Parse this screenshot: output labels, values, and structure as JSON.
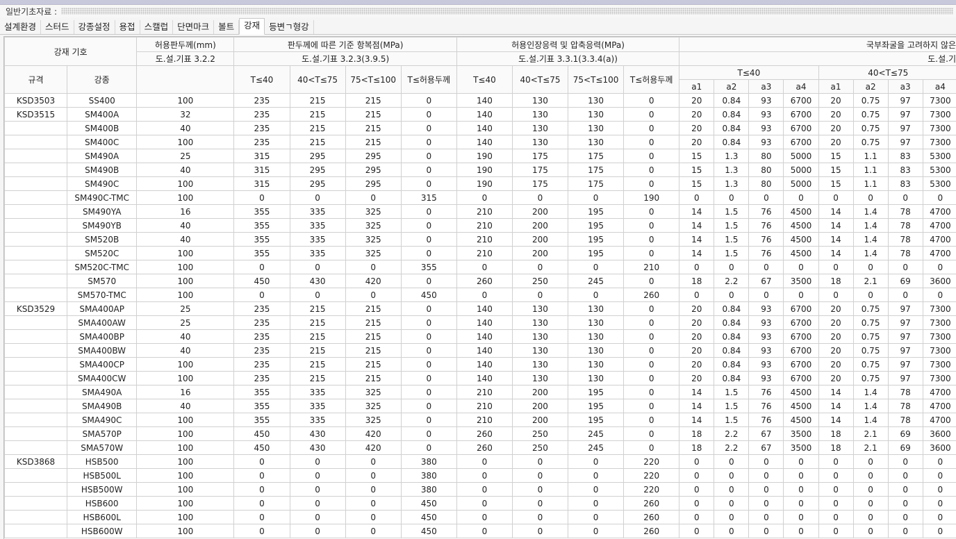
{
  "window": {
    "title": "일반기초자료 :"
  },
  "tabs": [
    {
      "label": "설계환경",
      "active": false
    },
    {
      "label": "스터드",
      "active": false
    },
    {
      "label": "강종설정",
      "active": false
    },
    {
      "label": "용접",
      "active": false
    },
    {
      "label": "스캘럽",
      "active": false
    },
    {
      "label": "단면마크",
      "active": false
    },
    {
      "label": "볼트",
      "active": false
    },
    {
      "label": "강재",
      "active": true
    },
    {
      "label": "등변ㄱ형강",
      "active": false
    }
  ],
  "header": {
    "steel_symbol": "강재 기호",
    "allow_thick": "허용판두께(mm)",
    "allow_thick_ref": "도.설.기표 3.2.2",
    "yield": "판두께에 따른 기준 항복점(MPa)",
    "yield_ref": "도.설.기표 3.2.3(3.9.5)",
    "tensile": "허용인장응력 및 압축응력(MPa)",
    "tensile_ref": "도.설.기표 3.3.1(3.3.4(a))",
    "buckling": "국부좌굴을 고려하지 않은",
    "buckling_ref": "도.설.기",
    "spec": "규격",
    "grade": "강종",
    "sub": [
      "T≤40",
      "40<T≤75",
      "75<T≤100",
      "T≤허용두께",
      "T≤40",
      "40<T≤75",
      "75<T≤100",
      "T≤허용두께"
    ],
    "group1": "T≤40",
    "group2": "40<T≤75",
    "alabels": [
      "a1",
      "a2",
      "a3",
      "a4",
      "a1",
      "a2",
      "a3",
      "a4"
    ]
  },
  "rows": [
    [
      "KSD3503",
      "SS400",
      "100",
      "235",
      "215",
      "215",
      "0",
      "140",
      "130",
      "130",
      "0",
      "20",
      "0.84",
      "93",
      "6700",
      "20",
      "0.75",
      "97",
      "7300"
    ],
    [
      "KSD3515",
      "SM400A",
      "32",
      "235",
      "215",
      "215",
      "0",
      "140",
      "130",
      "130",
      "0",
      "20",
      "0.84",
      "93",
      "6700",
      "20",
      "0.75",
      "97",
      "7300"
    ],
    [
      "",
      "SM400B",
      "40",
      "235",
      "215",
      "215",
      "0",
      "140",
      "130",
      "130",
      "0",
      "20",
      "0.84",
      "93",
      "6700",
      "20",
      "0.75",
      "97",
      "7300"
    ],
    [
      "",
      "SM400C",
      "100",
      "235",
      "215",
      "215",
      "0",
      "140",
      "130",
      "130",
      "0",
      "20",
      "0.84",
      "93",
      "6700",
      "20",
      "0.75",
      "97",
      "7300"
    ],
    [
      "",
      "SM490A",
      "25",
      "315",
      "295",
      "295",
      "0",
      "190",
      "175",
      "175",
      "0",
      "15",
      "1.3",
      "80",
      "5000",
      "15",
      "1.1",
      "83",
      "5300"
    ],
    [
      "",
      "SM490B",
      "40",
      "315",
      "295",
      "295",
      "0",
      "190",
      "175",
      "175",
      "0",
      "15",
      "1.3",
      "80",
      "5000",
      "15",
      "1.1",
      "83",
      "5300"
    ],
    [
      "",
      "SM490C",
      "100",
      "315",
      "295",
      "295",
      "0",
      "190",
      "175",
      "175",
      "0",
      "15",
      "1.3",
      "80",
      "5000",
      "15",
      "1.1",
      "83",
      "5300"
    ],
    [
      "",
      "SM490C-TMC",
      "100",
      "0",
      "0",
      "0",
      "315",
      "0",
      "0",
      "0",
      "190",
      "0",
      "0",
      "0",
      "0",
      "0",
      "0",
      "0",
      "0"
    ],
    [
      "",
      "SM490YA",
      "16",
      "355",
      "335",
      "325",
      "0",
      "210",
      "200",
      "195",
      "0",
      "14",
      "1.5",
      "76",
      "4500",
      "14",
      "1.4",
      "78",
      "4700"
    ],
    [
      "",
      "SM490YB",
      "40",
      "355",
      "335",
      "325",
      "0",
      "210",
      "200",
      "195",
      "0",
      "14",
      "1.5",
      "76",
      "4500",
      "14",
      "1.4",
      "78",
      "4700"
    ],
    [
      "",
      "SM520B",
      "40",
      "355",
      "335",
      "325",
      "0",
      "210",
      "200",
      "195",
      "0",
      "14",
      "1.5",
      "76",
      "4500",
      "14",
      "1.4",
      "78",
      "4700"
    ],
    [
      "",
      "SM520C",
      "100",
      "355",
      "335",
      "325",
      "0",
      "210",
      "200",
      "195",
      "0",
      "14",
      "1.5",
      "76",
      "4500",
      "14",
      "1.4",
      "78",
      "4700"
    ],
    [
      "",
      "SM520C-TMC",
      "100",
      "0",
      "0",
      "0",
      "355",
      "0",
      "0",
      "0",
      "210",
      "0",
      "0",
      "0",
      "0",
      "0",
      "0",
      "0",
      "0"
    ],
    [
      "",
      "SM570",
      "100",
      "450",
      "430",
      "420",
      "0",
      "260",
      "250",
      "245",
      "0",
      "18",
      "2.2",
      "67",
      "3500",
      "18",
      "2.1",
      "69",
      "3600"
    ],
    [
      "",
      "SM570-TMC",
      "100",
      "0",
      "0",
      "0",
      "450",
      "0",
      "0",
      "0",
      "260",
      "0",
      "0",
      "0",
      "0",
      "0",
      "0",
      "0",
      "0"
    ],
    [
      "KSD3529",
      "SMA400AP",
      "25",
      "235",
      "215",
      "215",
      "0",
      "140",
      "130",
      "130",
      "0",
      "20",
      "0.84",
      "93",
      "6700",
      "20",
      "0.75",
      "97",
      "7300"
    ],
    [
      "",
      "SMA400AW",
      "25",
      "235",
      "215",
      "215",
      "0",
      "140",
      "130",
      "130",
      "0",
      "20",
      "0.84",
      "93",
      "6700",
      "20",
      "0.75",
      "97",
      "7300"
    ],
    [
      "",
      "SMA400BP",
      "40",
      "235",
      "215",
      "215",
      "0",
      "140",
      "130",
      "130",
      "0",
      "20",
      "0.84",
      "93",
      "6700",
      "20",
      "0.75",
      "97",
      "7300"
    ],
    [
      "",
      "SMA400BW",
      "40",
      "235",
      "215",
      "215",
      "0",
      "140",
      "130",
      "130",
      "0",
      "20",
      "0.84",
      "93",
      "6700",
      "20",
      "0.75",
      "97",
      "7300"
    ],
    [
      "",
      "SMA400CP",
      "100",
      "235",
      "215",
      "215",
      "0",
      "140",
      "130",
      "130",
      "0",
      "20",
      "0.84",
      "93",
      "6700",
      "20",
      "0.75",
      "97",
      "7300"
    ],
    [
      "",
      "SMA400CW",
      "100",
      "235",
      "215",
      "215",
      "0",
      "140",
      "130",
      "130",
      "0",
      "20",
      "0.84",
      "93",
      "6700",
      "20",
      "0.75",
      "97",
      "7300"
    ],
    [
      "",
      "SMA490A",
      "16",
      "355",
      "335",
      "325",
      "0",
      "210",
      "200",
      "195",
      "0",
      "14",
      "1.5",
      "76",
      "4500",
      "14",
      "1.4",
      "78",
      "4700"
    ],
    [
      "",
      "SMA490B",
      "40",
      "355",
      "335",
      "325",
      "0",
      "210",
      "200",
      "195",
      "0",
      "14",
      "1.5",
      "76",
      "4500",
      "14",
      "1.4",
      "78",
      "4700"
    ],
    [
      "",
      "SMA490C",
      "100",
      "355",
      "335",
      "325",
      "0",
      "210",
      "200",
      "195",
      "0",
      "14",
      "1.5",
      "76",
      "4500",
      "14",
      "1.4",
      "78",
      "4700"
    ],
    [
      "",
      "SMA570P",
      "100",
      "450",
      "430",
      "420",
      "0",
      "260",
      "250",
      "245",
      "0",
      "18",
      "2.2",
      "67",
      "3500",
      "18",
      "2.1",
      "69",
      "3600"
    ],
    [
      "",
      "SMA570W",
      "100",
      "450",
      "430",
      "420",
      "0",
      "260",
      "250",
      "245",
      "0",
      "18",
      "2.2",
      "67",
      "3500",
      "18",
      "2.1",
      "69",
      "3600"
    ],
    [
      "KSD3868",
      "HSB500",
      "100",
      "0",
      "0",
      "0",
      "380",
      "0",
      "0",
      "0",
      "220",
      "0",
      "0",
      "0",
      "0",
      "0",
      "0",
      "0",
      "0"
    ],
    [
      "",
      "HSB500L",
      "100",
      "0",
      "0",
      "0",
      "380",
      "0",
      "0",
      "0",
      "220",
      "0",
      "0",
      "0",
      "0",
      "0",
      "0",
      "0",
      "0"
    ],
    [
      "",
      "HSB500W",
      "100",
      "0",
      "0",
      "0",
      "380",
      "0",
      "0",
      "0",
      "220",
      "0",
      "0",
      "0",
      "0",
      "0",
      "0",
      "0",
      "0"
    ],
    [
      "",
      "HSB600",
      "100",
      "0",
      "0",
      "0",
      "450",
      "0",
      "0",
      "0",
      "260",
      "0",
      "0",
      "0",
      "0",
      "0",
      "0",
      "0",
      "0"
    ],
    [
      "",
      "HSB600L",
      "100",
      "0",
      "0",
      "0",
      "450",
      "0",
      "0",
      "0",
      "260",
      "0",
      "0",
      "0",
      "0",
      "0",
      "0",
      "0",
      "0"
    ],
    [
      "",
      "HSB600W",
      "100",
      "0",
      "0",
      "0",
      "450",
      "0",
      "0",
      "0",
      "260",
      "0",
      "0",
      "0",
      "0",
      "0",
      "0",
      "0",
      "0"
    ]
  ]
}
